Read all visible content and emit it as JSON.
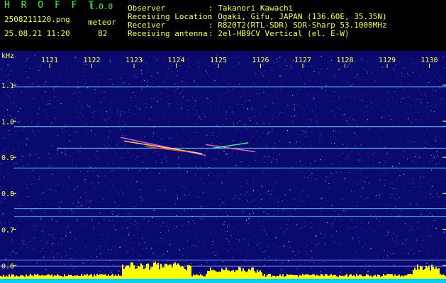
{
  "header": {
    "app_name": "H R O F F T",
    "version": "1.0.0",
    "filename": "2508211120.png",
    "datetime": "25.08.21 11:20",
    "meteor_label": "meteor",
    "meteor_count": "82",
    "info": [
      {
        "label": "Observer",
        "value": ": Takanori Kawachi"
      },
      {
        "label": "Receiving Location",
        "value": ": Ogaki, Gifu, JAPAN (136.60E, 35.35N)"
      },
      {
        "label": "Receiver",
        "value": ": R820T2(RTL-SDR) SDR-Sharp 53.1000MHz"
      },
      {
        "label": "Receiving antenna",
        "value": ": 2el-HB9CV Vertical (el. E-W)"
      }
    ]
  },
  "plot": {
    "y_unit": "kHz",
    "x_ticks": [
      "1121",
      "1122",
      "1123",
      "1124",
      "1125",
      "1126",
      "1127",
      "1128",
      "1129",
      "1130"
    ],
    "y_ticks": [
      "1.1",
      "1.0",
      "0.9",
      "0.8",
      "0.7",
      "0.6"
    ],
    "y_range": [
      0.575,
      1.175
    ],
    "colors": {
      "background": "#0a0a6e",
      "axis_text": "#ffff33",
      "header_text": "#33ff33",
      "level_bar": "#ffff00",
      "baseline": "#00ccff"
    }
  }
}
